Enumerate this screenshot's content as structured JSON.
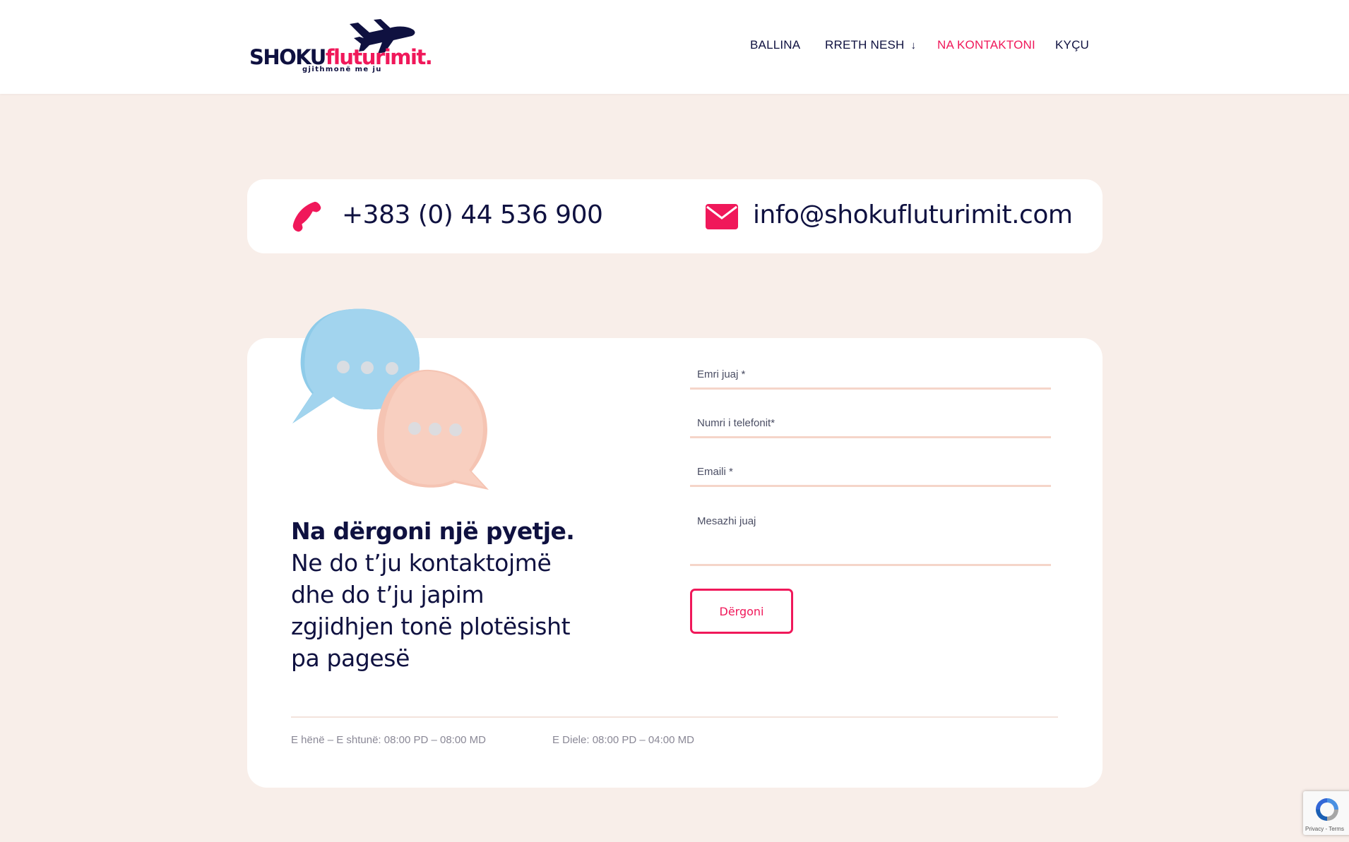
{
  "logo": {
    "brand_part1": "SHOKU",
    "brand_part2": "fluturimit.",
    "tagline": "gjithmonë me ju"
  },
  "nav": {
    "items": [
      {
        "label": "BALLINA"
      },
      {
        "label": "RRETH NESH",
        "has_dropdown": true
      },
      {
        "label": "NA KONTAKTONI",
        "active": true
      },
      {
        "label": "KYÇU"
      }
    ]
  },
  "contact": {
    "phone": "+383 (0) 44 536 900",
    "phone_icon": "phone-icon",
    "email": "info@shokufluturimit.com",
    "email_icon": "envelope-icon"
  },
  "form_section": {
    "headline_bold": "Na dërgoni një pyetje.",
    "headline_rest": "Ne do t’ju kontaktojmë dhe do t’ju japim zgjidhjen tonë plotësisht pa pagesë",
    "fields": {
      "name": "Emri juaj *",
      "phone": "Numri i telefonit*",
      "email": "Emaili *",
      "message": "Mesazhi juaj"
    },
    "submit_label": "Dërgoni",
    "hours_weekdays": "E hënë – E shtunë: 08:00 PD – 08:00 MD",
    "hours_sunday": "E Diele: 08:00 PD – 04:00 MD"
  },
  "recaptcha": {
    "links": "Privacy - Terms"
  },
  "colors": {
    "accent": "#f0185a",
    "navy": "#0f1140",
    "background": "#f8eee9",
    "field_underline": "#f5d5c9"
  }
}
